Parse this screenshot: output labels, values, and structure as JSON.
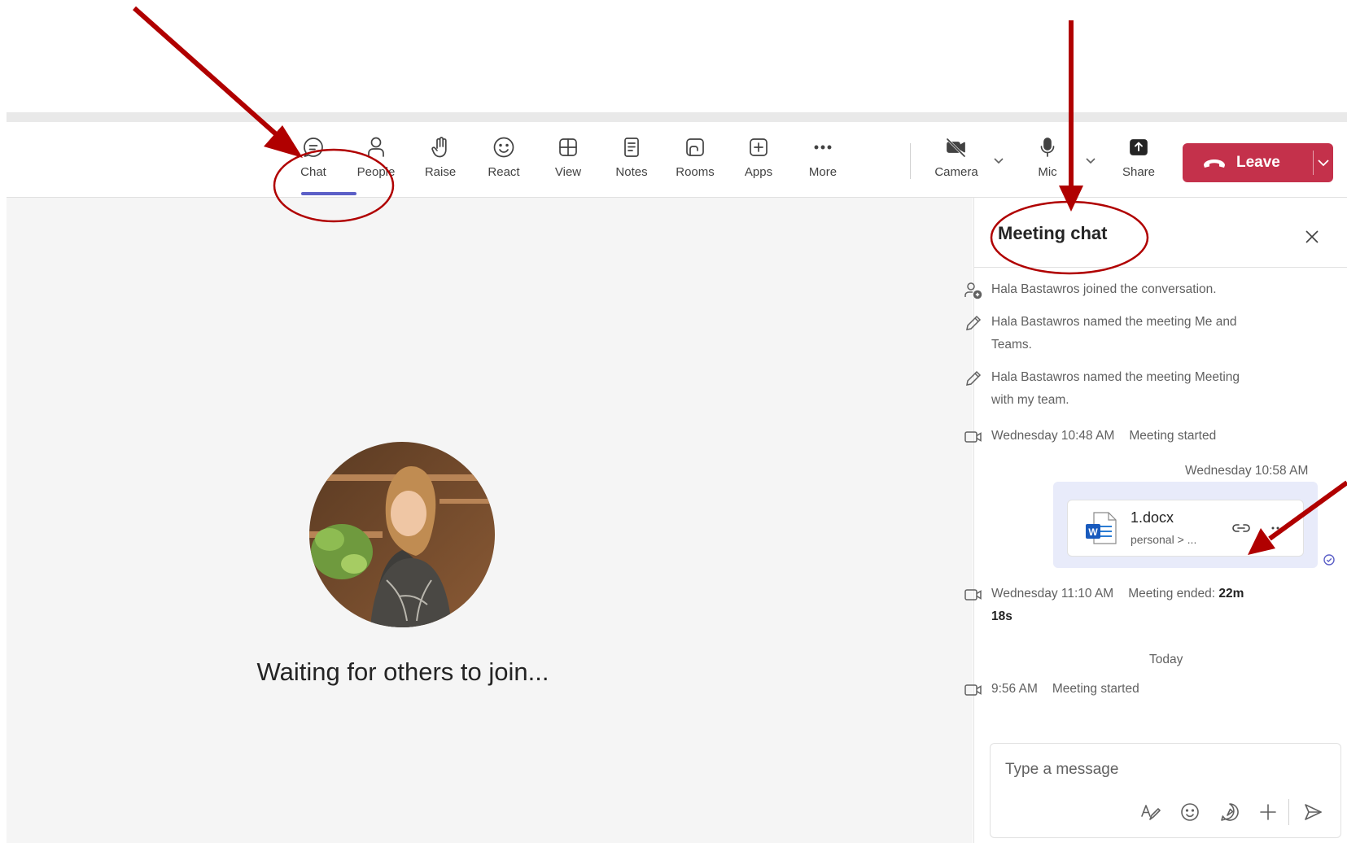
{
  "toolbar": {
    "items": [
      {
        "label": "Chat",
        "icon": "chat-icon"
      },
      {
        "label": "People",
        "icon": "people-icon"
      },
      {
        "label": "Raise",
        "icon": "raise-hand-icon"
      },
      {
        "label": "React",
        "icon": "smile-icon"
      },
      {
        "label": "View",
        "icon": "view-grid-icon"
      },
      {
        "label": "Notes",
        "icon": "notes-icon"
      },
      {
        "label": "Rooms",
        "icon": "rooms-icon"
      },
      {
        "label": "Apps",
        "icon": "apps-plus-icon"
      },
      {
        "label": "More",
        "icon": "more-dots-icon"
      },
      {
        "label": "Camera",
        "icon": "camera-off-icon"
      },
      {
        "label": "Mic",
        "icon": "mic-icon"
      },
      {
        "label": "Share",
        "icon": "share-icon"
      }
    ],
    "active": "Chat",
    "leave_label": "Leave"
  },
  "stage": {
    "status_text": "Waiting for others to join..."
  },
  "chat": {
    "title": "Meeting chat",
    "events": [
      {
        "icon": "person-add-icon",
        "text": "Hala Bastawros joined the conversation."
      },
      {
        "icon": "pencil-icon",
        "text_line1": "Hala Bastawros named the meeting Me and",
        "text_line2": "Teams."
      },
      {
        "icon": "pencil-icon",
        "text_line1": "Hala Bastawros named the meeting Meeting",
        "text_line2": "with my team."
      },
      {
        "icon": "video-icon",
        "time": "Wednesday 10:48 AM",
        "text": "Meeting started"
      },
      {
        "icon": "video-icon",
        "time": "Wednesday 11:10 AM",
        "text": "Meeting ended:",
        "duration_line1": "22m",
        "duration_line2": "18s"
      },
      {
        "icon": "video-icon",
        "time": "9:56 AM",
        "text": "Meeting started"
      }
    ],
    "message_timestamp": "Wednesday 10:58 AM",
    "attachment": {
      "name": "1.docx",
      "path": "personal > ...",
      "icon": "word-doc-icon"
    },
    "day_divider": "Today",
    "composer": {
      "placeholder": "Type a message"
    }
  },
  "colors": {
    "accent": "#5b5fc7",
    "leave": "#c4314b",
    "annotation": "#b00000"
  }
}
